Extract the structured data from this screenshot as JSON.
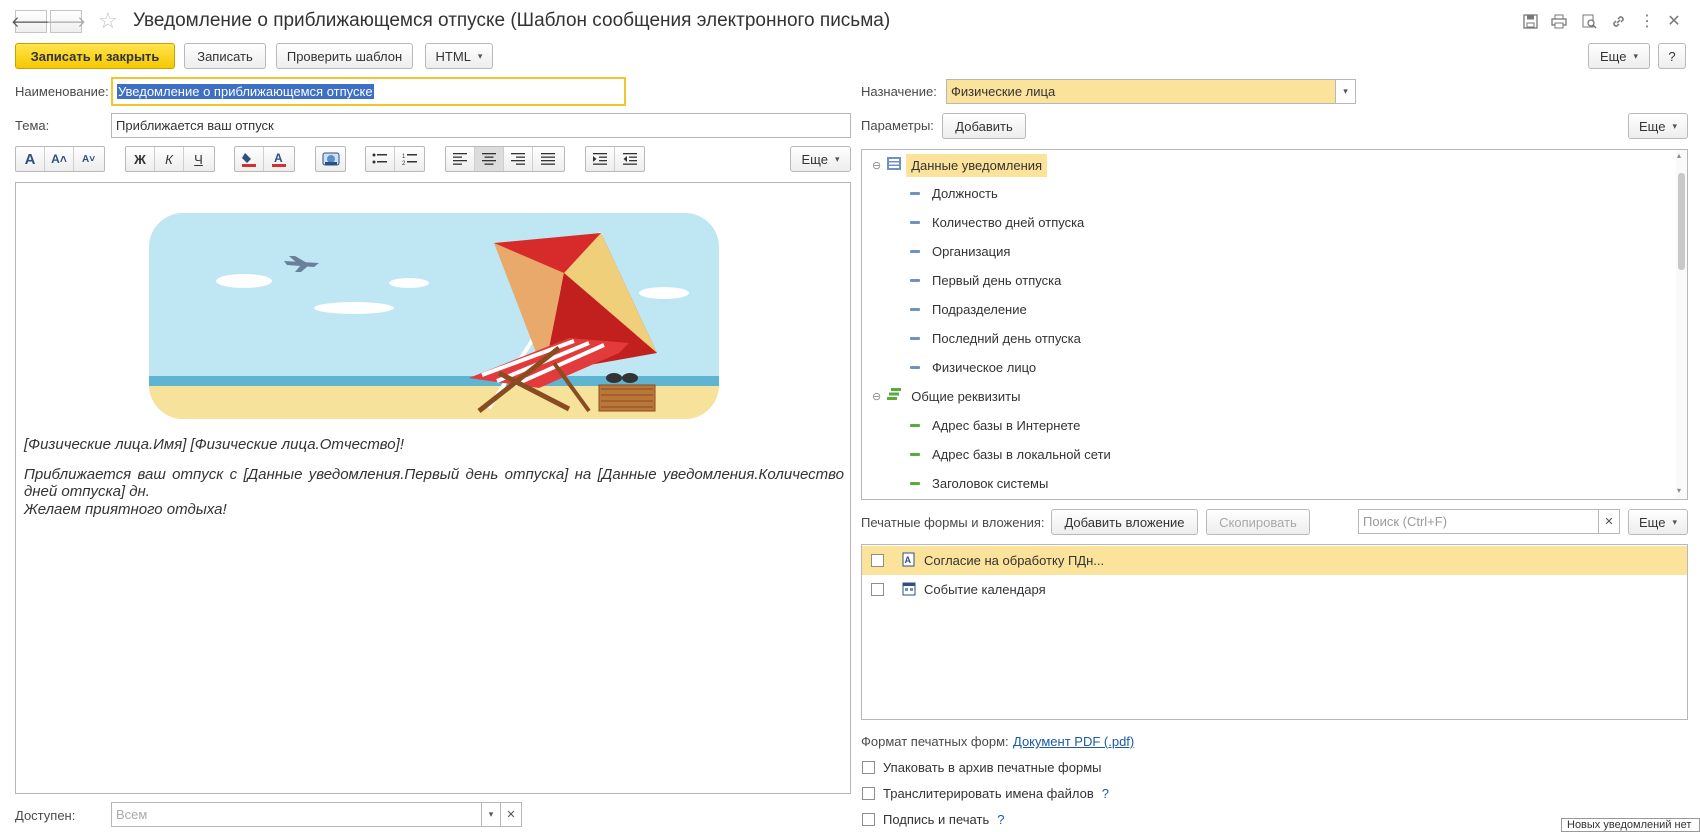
{
  "window": {
    "title": "Уведомление о приближающемся отпуске (Шаблон сообщения электронного письма)"
  },
  "toolbar": {
    "save_close": "Записать и закрыть",
    "save": "Записать",
    "check_template": "Проверить шаблон",
    "html": "HTML",
    "more": "Еще",
    "help": "?"
  },
  "form": {
    "name_label": "Наименование:",
    "name_value": "Уведомление о приближающемся отпуске",
    "subject_label": "Тема:",
    "subject_value": "Приближается ваш отпуск",
    "available_label": "Доступен:",
    "available_placeholder": "Всем"
  },
  "editor": {
    "more": "Еще",
    "line1": "[Физические лица.Имя] [Физические лица.Отчество]!",
    "line2": "Приближается ваш отпуск с [Данные уведомления.Первый день отпуска] на [Данные уведомления.Количество дней отпуска] дн.",
    "line3": "Желаем приятного отдыха!",
    "format_buttons": [
      "A",
      "A˄",
      "A˅",
      "Ж",
      "К",
      "Ч"
    ]
  },
  "right": {
    "purpose_label": "Назначение:",
    "purpose_value": "Физические лица",
    "params_label": "Параметры:",
    "add": "Добавить",
    "more": "Еще",
    "tree": {
      "group1": "Данные уведомления",
      "group1_items": [
        "Должность",
        "Количество дней отпуска",
        "Организация",
        "Первый день отпуска",
        "Подразделение",
        "Последний день отпуска",
        "Физическое лицо"
      ],
      "group2": "Общие реквизиты",
      "group2_items": [
        "Адрес базы в Интернете",
        "Адрес базы в локальной сети",
        "Заголовок системы"
      ]
    },
    "attachments_label": "Печатные формы и вложения:",
    "add_attachment": "Добавить вложение",
    "copy": "Скопировать",
    "search_placeholder": "Поиск (Ctrl+F)",
    "attachments": [
      "Согласие на обработку ПДн...",
      "Событие календаря"
    ],
    "format_label": "Формат печатных форм:",
    "format_value": "Документ PDF (.pdf)",
    "option1": "Упаковать в архив печатные формы",
    "option2": "Транслитерировать имена файлов",
    "option3": "Подпись и печать",
    "question": "?"
  },
  "status": {
    "notification": "Новых уведомлений нет"
  },
  "colors": {
    "accent_yellow": "#f5c800",
    "selection_yellow": "#fce39b",
    "link_blue": "#1a5aa6"
  }
}
